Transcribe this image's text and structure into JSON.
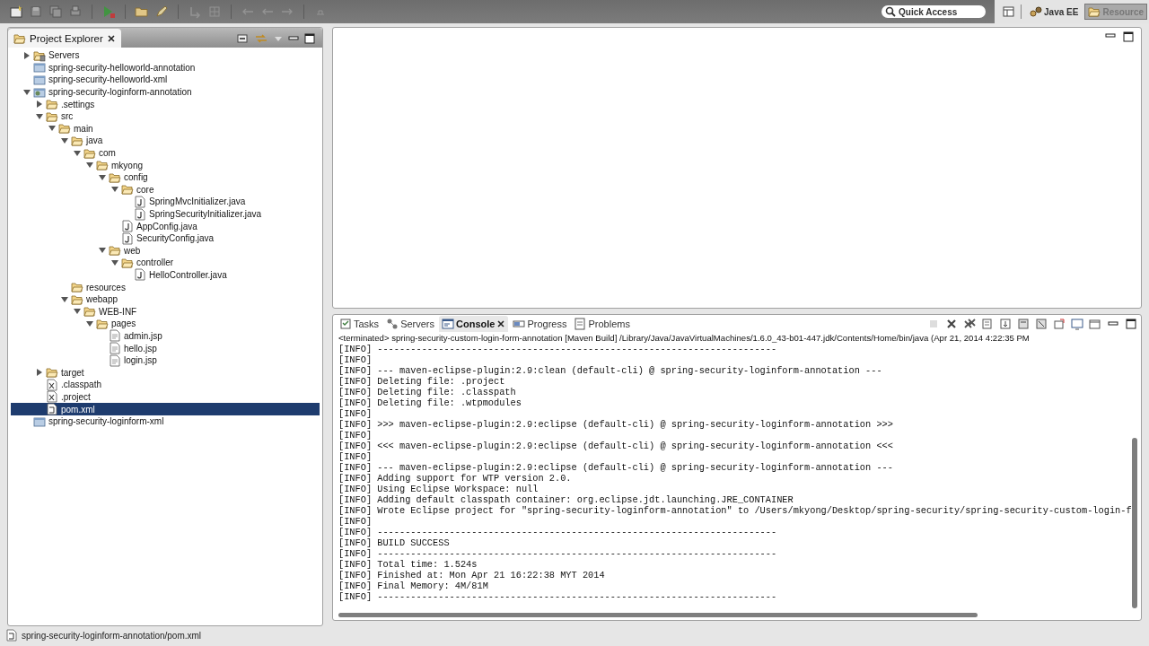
{
  "toolbar": {
    "quick_access": {
      "placeholder": "Quick Access"
    },
    "perspectives": [
      {
        "label": "Java EE",
        "selected": false
      },
      {
        "label": "Resource",
        "selected": true
      }
    ]
  },
  "project_explorer": {
    "title": "Project Explorer",
    "tree": [
      {
        "label": "Servers",
        "kind": "servers",
        "expanded": false,
        "selected": false
      },
      {
        "label": "spring-security-helloworld-annotation",
        "kind": "project",
        "selected": false
      },
      {
        "label": "spring-security-helloworld-xml",
        "kind": "project",
        "selected": false
      },
      {
        "label": "spring-security-loginform-annotation",
        "kind": "web-project",
        "expanded": true,
        "selected": false,
        "children": [
          {
            "label": ".settings",
            "kind": "folder",
            "expanded": false,
            "selected": false
          },
          {
            "label": "src",
            "kind": "folder",
            "expanded": true,
            "selected": false,
            "children": [
              {
                "label": "main",
                "kind": "folder",
                "expanded": true,
                "selected": false,
                "children": [
                  {
                    "label": "java",
                    "kind": "folder",
                    "expanded": true,
                    "selected": false,
                    "children": [
                      {
                        "label": "com",
                        "kind": "folder",
                        "expanded": true,
                        "selected": false,
                        "children": [
                          {
                            "label": "mkyong",
                            "kind": "folder",
                            "expanded": true,
                            "selected": false,
                            "children": [
                              {
                                "label": "config",
                                "kind": "folder",
                                "expanded": true,
                                "selected": false,
                                "children": [
                                  {
                                    "label": "core",
                                    "kind": "folder",
                                    "expanded": true,
                                    "selected": false,
                                    "children": [
                                      {
                                        "label": "SpringMvcInitializer.java",
                                        "kind": "java",
                                        "selected": false
                                      },
                                      {
                                        "label": "SpringSecurityInitializer.java",
                                        "kind": "java",
                                        "selected": false
                                      }
                                    ]
                                  },
                                  {
                                    "label": "AppConfig.java",
                                    "kind": "java",
                                    "selected": false
                                  },
                                  {
                                    "label": "SecurityConfig.java",
                                    "kind": "java",
                                    "selected": false
                                  }
                                ]
                              },
                              {
                                "label": "web",
                                "kind": "folder",
                                "expanded": true,
                                "selected": false,
                                "children": [
                                  {
                                    "label": "controller",
                                    "kind": "folder",
                                    "expanded": true,
                                    "selected": false,
                                    "children": [
                                      {
                                        "label": "HelloController.java",
                                        "kind": "java",
                                        "selected": false
                                      }
                                    ]
                                  }
                                ]
                              }
                            ]
                          }
                        ]
                      }
                    ]
                  },
                  {
                    "label": "resources",
                    "kind": "folder",
                    "selected": false
                  },
                  {
                    "label": "webapp",
                    "kind": "folder",
                    "expanded": true,
                    "selected": false,
                    "children": [
                      {
                        "label": "WEB-INF",
                        "kind": "folder",
                        "expanded": true,
                        "selected": false,
                        "children": [
                          {
                            "label": "pages",
                            "kind": "folder",
                            "expanded": true,
                            "selected": false,
                            "children": [
                              {
                                "label": "admin.jsp",
                                "kind": "jsp",
                                "selected": false
                              },
                              {
                                "label": "hello.jsp",
                                "kind": "jsp",
                                "selected": false
                              },
                              {
                                "label": "login.jsp",
                                "kind": "jsp",
                                "selected": false
                              }
                            ]
                          }
                        ]
                      }
                    ]
                  }
                ]
              }
            ]
          },
          {
            "label": "target",
            "kind": "folder",
            "expanded": false,
            "selected": false
          },
          {
            "label": ".classpath",
            "kind": "xml",
            "selected": false
          },
          {
            "label": ".project",
            "kind": "xml",
            "selected": false
          },
          {
            "label": "pom.xml",
            "kind": "pom",
            "selected": true
          }
        ]
      },
      {
        "label": "spring-security-loginform-xml",
        "kind": "project",
        "selected": false
      }
    ]
  },
  "console_view": {
    "tabs": [
      {
        "label": "Tasks",
        "kind": "tasks",
        "selected": false
      },
      {
        "label": "Servers",
        "kind": "servers",
        "selected": false
      },
      {
        "label": "Console",
        "kind": "console",
        "selected": true
      },
      {
        "label": "Progress",
        "kind": "progress",
        "selected": false
      },
      {
        "label": "Problems",
        "kind": "problems",
        "selected": false
      }
    ],
    "header": "<terminated> spring-security-custom-login-form-annotation [Maven Build] /Library/Java/JavaVirtualMachines/1.6.0_43-b01-447.jdk/Contents/Home/bin/java (Apr 21, 2014 4:22:35 PM",
    "lines": [
      "[INFO] ------------------------------------------------------------------------",
      "[INFO]",
      "[INFO] --- maven-eclipse-plugin:2.9:clean (default-cli) @ spring-security-loginform-annotation ---",
      "[INFO] Deleting file: .project",
      "[INFO] Deleting file: .classpath",
      "[INFO] Deleting file: .wtpmodules",
      "[INFO]",
      "[INFO] >>> maven-eclipse-plugin:2.9:eclipse (default-cli) @ spring-security-loginform-annotation >>>",
      "[INFO]",
      "[INFO] <<< maven-eclipse-plugin:2.9:eclipse (default-cli) @ spring-security-loginform-annotation <<<",
      "[INFO]",
      "[INFO] --- maven-eclipse-plugin:2.9:eclipse (default-cli) @ spring-security-loginform-annotation ---",
      "[INFO] Adding support for WTP version 2.0.",
      "[INFO] Using Eclipse Workspace: null",
      "[INFO] Adding default classpath container: org.eclipse.jdt.launching.JRE_CONTAINER",
      "[INFO] Wrote Eclipse project for \"spring-security-loginform-annotation\" to /Users/mkyong/Desktop/spring-security/spring-security-custom-login-f",
      "[INFO]",
      "[INFO] ------------------------------------------------------------------------",
      "[INFO] BUILD SUCCESS",
      "[INFO] ------------------------------------------------------------------------",
      "[INFO] Total time: 1.524s",
      "[INFO] Finished at: Mon Apr 21 16:22:38 MYT 2014",
      "[INFO] Final Memory: 4M/81M",
      "[INFO] ------------------------------------------------------------------------"
    ]
  },
  "status_bar": {
    "text": "spring-security-loginform-annotation/pom.xml"
  }
}
